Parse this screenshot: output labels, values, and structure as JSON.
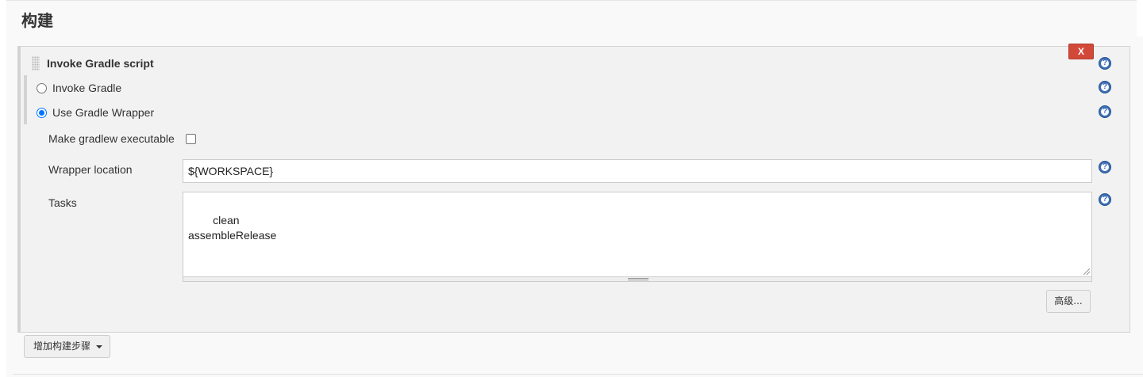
{
  "section": {
    "title": "构建"
  },
  "step": {
    "title": "Invoke Gradle script",
    "delete_label": "X",
    "options": [
      {
        "label": "Invoke Gradle",
        "checked": false
      },
      {
        "label": "Use Gradle Wrapper",
        "checked": true
      }
    ],
    "make_executable_label": "Make gradlew executable",
    "make_executable_checked": false,
    "wrapper_location_label": "Wrapper location",
    "wrapper_location_value": "${WORKSPACE}",
    "tasks_label": "Tasks",
    "tasks_value": "clean\nassembleRelease",
    "advanced_label": "高级..."
  },
  "add_step": {
    "label": "增加构建步骤"
  },
  "icons": {
    "help": "help-icon",
    "drag": "drag-handle-icon",
    "dropdown": "caret-down-icon"
  },
  "colors": {
    "delete_button": "#d24939",
    "help_icon": "#3c6eb4",
    "radio_checked": "#0075ff"
  }
}
